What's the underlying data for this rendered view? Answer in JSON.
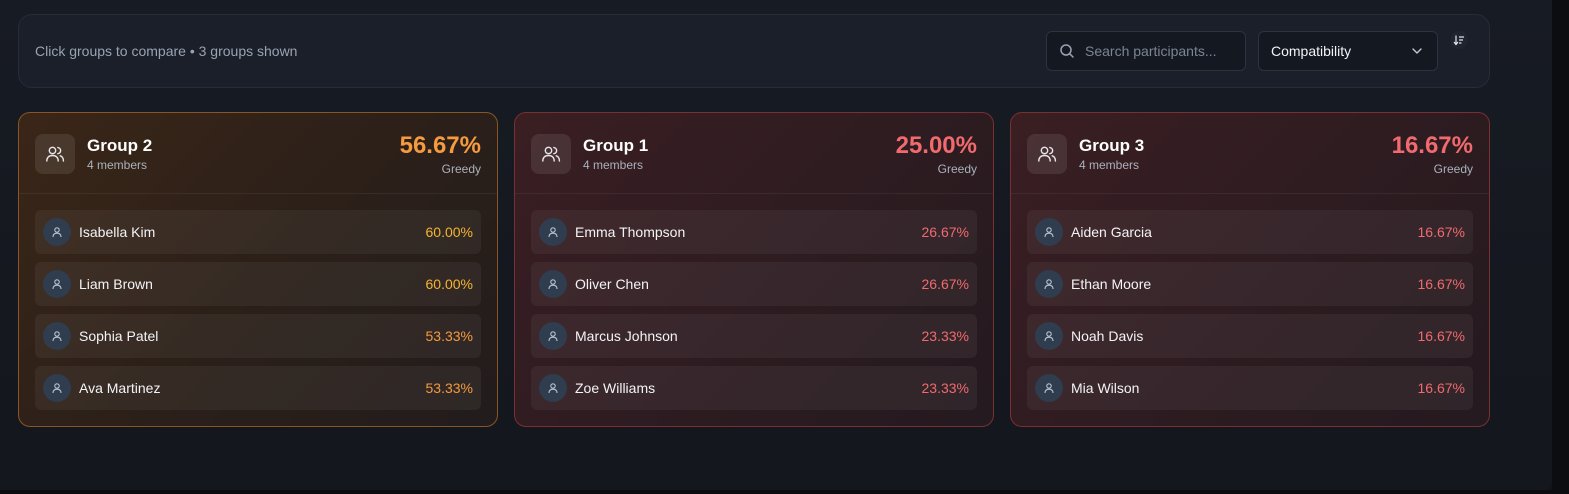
{
  "toolbar": {
    "hint": "Click groups to compare • 3 groups shown",
    "search_placeholder": "Search participants...",
    "sort_by": "Compatibility"
  },
  "colors": {
    "orange_accent": "#f59a3e",
    "yellow_accent": "#f5b431",
    "red_accent": "#f06a6e"
  },
  "groups": [
    {
      "name": "Group 2",
      "members_label": "4 members",
      "percent": "56.67%",
      "strategy": "Greedy",
      "theme": "orange",
      "members": [
        {
          "name": "Isabella Kim",
          "percent": "60.00%"
        },
        {
          "name": "Liam Brown",
          "percent": "60.00%"
        },
        {
          "name": "Sophia Patel",
          "percent": "53.33%"
        },
        {
          "name": "Ava Martinez",
          "percent": "53.33%"
        }
      ]
    },
    {
      "name": "Group 1",
      "members_label": "4 members",
      "percent": "25.00%",
      "strategy": "Greedy",
      "theme": "red",
      "members": [
        {
          "name": "Emma Thompson",
          "percent": "26.67%"
        },
        {
          "name": "Oliver Chen",
          "percent": "26.67%"
        },
        {
          "name": "Marcus Johnson",
          "percent": "23.33%"
        },
        {
          "name": "Zoe Williams",
          "percent": "23.33%"
        }
      ]
    },
    {
      "name": "Group 3",
      "members_label": "4 members",
      "percent": "16.67%",
      "strategy": "Greedy",
      "theme": "red",
      "members": [
        {
          "name": "Aiden Garcia",
          "percent": "16.67%"
        },
        {
          "name": "Ethan Moore",
          "percent": "16.67%"
        },
        {
          "name": "Noah Davis",
          "percent": "16.67%"
        },
        {
          "name": "Mia Wilson",
          "percent": "16.67%"
        }
      ]
    }
  ]
}
